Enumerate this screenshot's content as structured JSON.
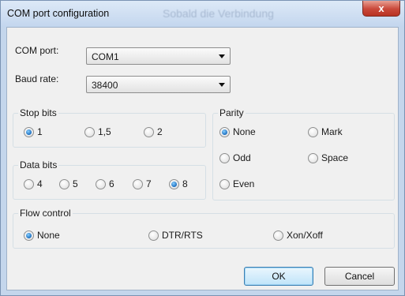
{
  "window": {
    "title": "COM port configuration",
    "background_title": "Sobald die Verbindung",
    "close_glyph": "x"
  },
  "com_port": {
    "label": "COM port:",
    "value": "COM1"
  },
  "baud_rate": {
    "label": "Baud rate:",
    "value": "38400"
  },
  "stop_bits": {
    "title": "Stop bits",
    "options": [
      "1",
      "1,5",
      "2"
    ],
    "selected": "1"
  },
  "data_bits": {
    "title": "Data bits",
    "options": [
      "4",
      "5",
      "6",
      "7",
      "8"
    ],
    "selected": "8"
  },
  "parity": {
    "title": "Parity",
    "options": [
      "None",
      "Mark",
      "Odd",
      "Space",
      "Even"
    ],
    "selected": "None"
  },
  "flow_control": {
    "title": "Flow control",
    "options": [
      "None",
      "DTR/RTS",
      "Xon/Xoff"
    ],
    "selected": "None"
  },
  "buttons": {
    "ok": "OK",
    "cancel": "Cancel"
  }
}
